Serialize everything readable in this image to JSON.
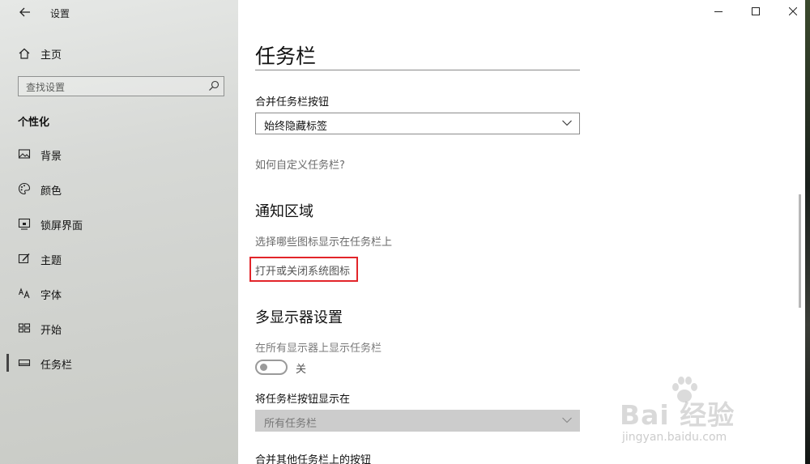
{
  "window": {
    "app_title": "设置",
    "controls": [
      "minimize",
      "maximize",
      "close"
    ]
  },
  "sidebar": {
    "home_label": "主页",
    "search_placeholder": "查找设置",
    "section_title": "个性化",
    "items": [
      {
        "label": "背景",
        "icon": "picture-icon"
      },
      {
        "label": "颜色",
        "icon": "palette-icon"
      },
      {
        "label": "锁屏界面",
        "icon": "lockscreen-icon"
      },
      {
        "label": "主题",
        "icon": "theme-brush-icon"
      },
      {
        "label": "字体",
        "icon": "font-icon"
      },
      {
        "label": "开始",
        "icon": "start-grid-icon"
      },
      {
        "label": "任务栏",
        "icon": "taskbar-icon",
        "active": true
      }
    ]
  },
  "main": {
    "page_title": "任务栏",
    "combine_label": "合并任务栏按钮",
    "combine_value": "始终隐藏标签",
    "customize_link": "如何自定义任务栏?",
    "notification": {
      "heading": "通知区域",
      "select_icons_link": "选择哪些图标显示在任务栏上",
      "system_icons_link": "打开或关闭系统图标"
    },
    "multi_display": {
      "heading": "多显示器设置",
      "show_all_label": "在所有显示器上显示任务栏",
      "toggle_state": "关",
      "show_buttons_label": "将任务栏按钮显示在",
      "show_buttons_value": "所有任务栏",
      "cut_label": "合并其他任务栏上的按钮"
    }
  },
  "watermark": {
    "brand": "Bai 经验",
    "url": "jingyan.baidu.com"
  },
  "colors": {
    "highlight_box": "#e2252a",
    "disabled_dropdown": "#cccccc"
  }
}
